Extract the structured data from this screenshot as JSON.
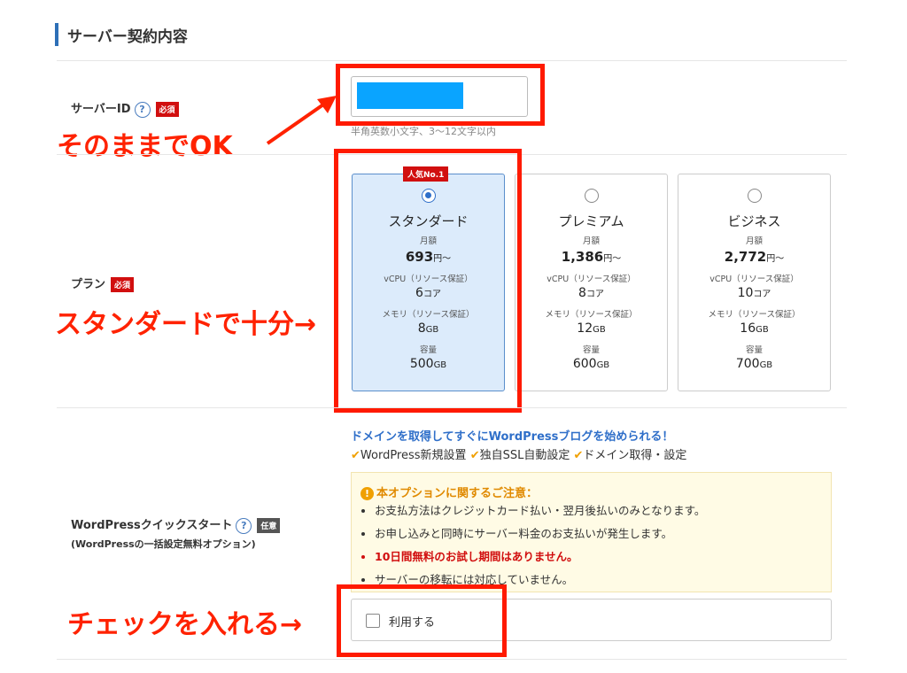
{
  "section": {
    "title": "サーバー契約内容"
  },
  "server_id": {
    "label": "サーバーID",
    "help": "?",
    "required": "必須",
    "hint": "半角英数小文字、3〜12文字以内"
  },
  "plan": {
    "label": "プラン",
    "required": "必須",
    "popular_badge": "人気No.1",
    "price_unit": "円〜",
    "monthly_label": "月額",
    "cpu_label": "vCPU（リソース保証）",
    "mem_label": "メモリ（リソース保証）",
    "storage_label": "容量",
    "core_unit": "コア",
    "gb_unit": "GB",
    "options": [
      {
        "name": "スタンダード",
        "price": "693",
        "cpu": "6",
        "memory": "8",
        "storage": "500",
        "selected": true
      },
      {
        "name": "プレミアム",
        "price": "1,386",
        "cpu": "8",
        "memory": "12",
        "storage": "600",
        "selected": false
      },
      {
        "name": "ビジネス",
        "price": "2,772",
        "cpu": "10",
        "memory": "16",
        "storage": "700",
        "selected": false
      }
    ]
  },
  "wp": {
    "label": "WordPressクイックスタート",
    "help": "?",
    "optional": "任意",
    "sublabel": "(WordPressの一括設定無料オプション)",
    "headline": "ドメインを取得してすぐにWordPressブログを始められる！",
    "features": [
      "WordPress新規設置",
      "独自SSL自動設定",
      "ドメイン取得・設定"
    ],
    "notice_title": "本オプションに関するご注意：",
    "notice_items": [
      "お支払方法はクレジットカード払い・翌月後払いのみとなります。",
      "お申し込みと同時にサーバー料金のお支払いが発生します。",
      "10日間無料のお試し期間はありません。",
      "サーバーの移転には対応していません。"
    ],
    "checkbox_label": "利用する"
  },
  "annotations": {
    "server_id": "そのままでOK",
    "plan": "スタンダードで十分→",
    "wp": "チェックを入れる→"
  },
  "colors": {
    "accent": "#2d6fb7",
    "required": "#d10f0f",
    "annotation": "#ff2200",
    "selected_bg": "#dcebfb"
  }
}
